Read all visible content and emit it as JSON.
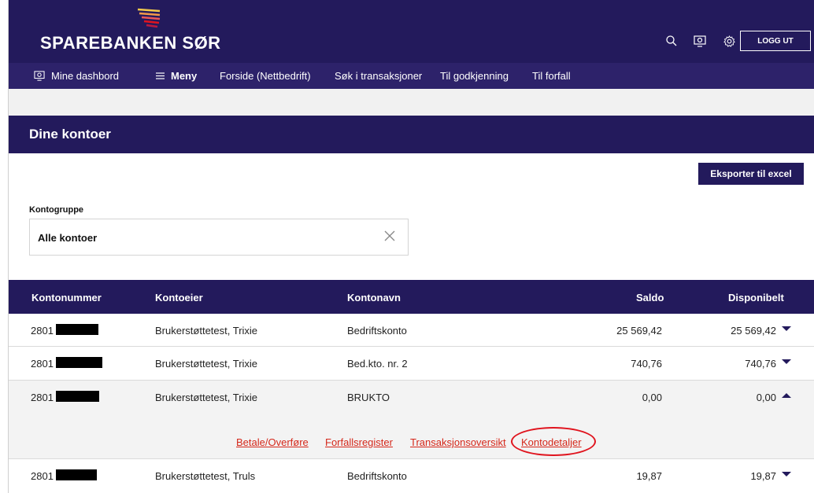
{
  "brand": {
    "name": "SPAREBANKEN SØR"
  },
  "header": {
    "icons": [
      "search-icon",
      "dashboard-icon",
      "gear-icon"
    ],
    "logout_label": "LOGG UT"
  },
  "nav": {
    "items": [
      {
        "label": "Mine dashbord",
        "icon": "dashboard-icon"
      },
      {
        "label": "Meny",
        "icon": "menu-icon"
      },
      {
        "label": "Forside (Nettbedrift)"
      },
      {
        "label": "Søk i transaksjoner"
      },
      {
        "label": "Til godkjenning"
      },
      {
        "label": "Til forfall"
      }
    ]
  },
  "section": {
    "title": "Dine kontoer",
    "export_label": "Eksporter til excel"
  },
  "filter": {
    "label": "Kontogruppe",
    "value": "Alle kontoer"
  },
  "table": {
    "headers": {
      "number": "Kontonummer",
      "owner": "Kontoeier",
      "name": "Kontonavn",
      "balance": "Saldo",
      "available": "Disponibelt"
    },
    "rows": [
      {
        "number": "2801",
        "owner": "Brukerstøttetest, Trixie",
        "name": "Bedriftskonto",
        "balance": "25 569,42",
        "available": "25 569,42"
      },
      {
        "number": "2801",
        "owner": "Brukerstøttetest, Trixie",
        "name": "Bed.kto. nr. 2",
        "balance": "740,76",
        "available": "740,76"
      },
      {
        "number": "2801",
        "owner": "Brukerstøttetest, Trixie",
        "name": "BRUKTO",
        "balance": "0,00",
        "available": "0,00"
      },
      {
        "number": "2801",
        "owner": "Brukerstøttetest, Truls",
        "name": "Bedriftskonto",
        "balance": "19,87",
        "available": "19,87"
      }
    ],
    "expanded_links": [
      "Betale/Overføre",
      "Forfallsregister",
      "Transaksjonsoversikt",
      "Kontodetaljer"
    ]
  },
  "colors": {
    "primary": "#231a5c",
    "nav": "#2d226a",
    "link": "#d5281b",
    "highlight": "#e0141e"
  }
}
